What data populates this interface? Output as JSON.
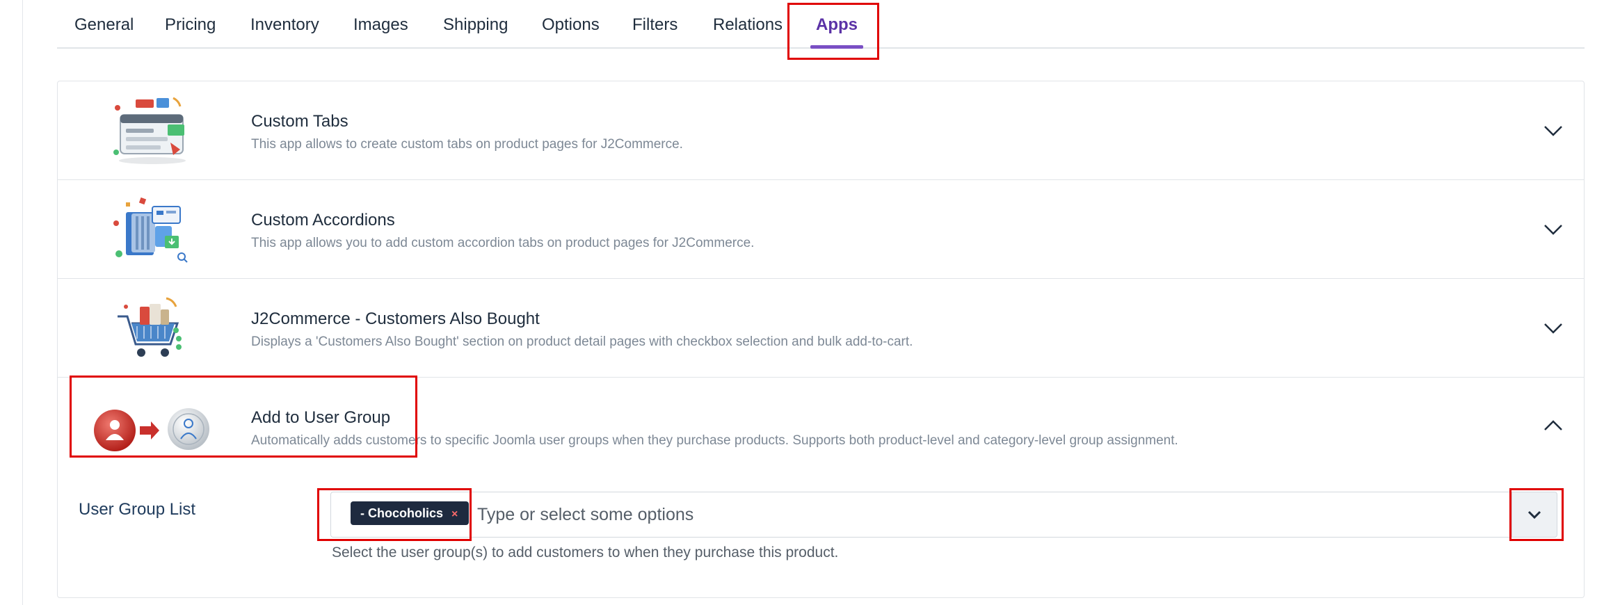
{
  "tabs": [
    {
      "label": "General"
    },
    {
      "label": "Pricing"
    },
    {
      "label": "Inventory"
    },
    {
      "label": "Images"
    },
    {
      "label": "Shipping"
    },
    {
      "label": "Options"
    },
    {
      "label": "Filters"
    },
    {
      "label": "Relations"
    },
    {
      "label": "Apps",
      "active": true
    }
  ],
  "apps": [
    {
      "title": "Custom Tabs",
      "description": "This app allows to create custom tabs on product pages for J2Commerce.",
      "icon": "custom-tabs-illustration"
    },
    {
      "title": "Custom Accordions",
      "description": "This app allows you to add custom accordion tabs on product pages for J2Commerce.",
      "icon": "custom-accordions-illustration"
    },
    {
      "title": "J2Commerce - Customers Also Bought",
      "description": "Displays a 'Customers Also Bought' section on product detail pages with checkbox selection and bulk add-to-cart.",
      "icon": "shopping-cart-illustration"
    },
    {
      "title": "Add to User Group",
      "description": "Automatically adds customers to specific Joomla user groups when they purchase products. Supports both product-level and category-level group assignment.",
      "icon": "user-to-group-illustration",
      "expanded": true
    }
  ],
  "user_group": {
    "label": "User Group List",
    "selected_chip": "- Chocoholics",
    "chip_remove": "×",
    "placeholder": "Type or select some options",
    "help": "Select the user group(s) to add customers to when they purchase this product."
  },
  "colors": {
    "accent": "#5b32a6",
    "highlight": "#e00000",
    "chip_bg": "#1e2a3f"
  }
}
